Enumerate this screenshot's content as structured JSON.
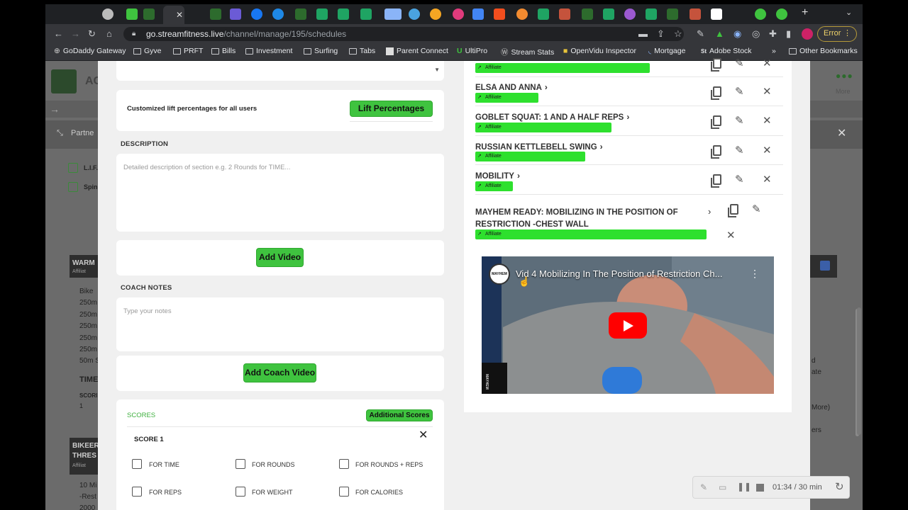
{
  "browser": {
    "url_host": "go.streamfitness.live",
    "url_path": "/channel/manage/195/schedules",
    "profile_status": "Error",
    "bookmarks": [
      "GoDaddy Gateway",
      "Gyve",
      "PRFT",
      "Bills",
      "Investment",
      "Surfing",
      "Tabs",
      "Parent Connect",
      "UltiPro",
      "Stream Stats",
      "OpenVidu Inspector",
      "Mortgage",
      "Adobe Stock",
      "»",
      "Other Bookmarks"
    ]
  },
  "background": {
    "brand_initials": "AC",
    "more_label": "More",
    "partner_label": "Partne",
    "list_items": [
      "L.I.F.",
      "Spin"
    ],
    "warmup_title": "WARM",
    "warmup_badge": "Affiliat",
    "warmup_lines": [
      "Bike",
      "250m",
      "250m",
      "250m",
      "250m",
      "250m",
      "50m S"
    ],
    "time_label": "TIME",
    "score_label": "SCORI",
    "score_value": "1",
    "bikeerg_title_1": "BIKEER",
    "bikeerg_title_2": "THRES",
    "bikeerg_badge": "Affiliat",
    "bikeerg_lines": [
      "10 Mi",
      "-Rest",
      "2000"
    ],
    "right_fragments": [
      "d",
      "ate",
      "More)",
      "ers"
    ]
  },
  "form": {
    "lift_text": "Customized lift percentages for all users",
    "lift_button": "Lift Percentages",
    "description_label": "DESCRIPTION",
    "description_placeholder": "Detailed description of section e.g. 2 Rounds for TIME...",
    "add_video": "Add Video",
    "coach_notes_label": "COACH NOTES",
    "coach_notes_placeholder": "Type your notes",
    "add_coach_video": "Add Coach Video",
    "scores_label": "SCORES",
    "additional_scores": "Additional Scores",
    "score1_label": "SCORE 1",
    "score_options": [
      "FOR TIME",
      "FOR ROUNDS",
      "FOR ROUNDS + REPS",
      "FOR REPS",
      "FOR WEIGHT",
      "FOR CALORIES"
    ]
  },
  "movements": [
    {
      "title": "ELSA AND ANNA",
      "badge": "Affiliate"
    },
    {
      "title": "GOBLET SQUAT: 1 AND A HALF REPS",
      "badge": "Affiliate"
    },
    {
      "title": "RUSSIAN KETTLEBELL SWING",
      "badge": "Affiliate"
    },
    {
      "title": "MOBILITY",
      "badge": "Affiliate"
    }
  ],
  "top_badge": "Affiliate",
  "mayhem": {
    "title_line1": "MAYHEM READY: MOBILIZING IN THE POSITION OF",
    "title_line2": "RESTRICTION -CHEST WALL",
    "badge": "Affiliate"
  },
  "video": {
    "title": "Vid 4 Mobilizing In The Position of Restriction Ch...",
    "channel_badge": "MAYHEM",
    "watermark": "MAYHEM"
  },
  "recorder": {
    "time": "01:34 / 30 min"
  },
  "colors": {
    "affiliate_green": "#2ee02e",
    "button_green": "#3fc33f",
    "chrome_dark": "#35363a"
  }
}
